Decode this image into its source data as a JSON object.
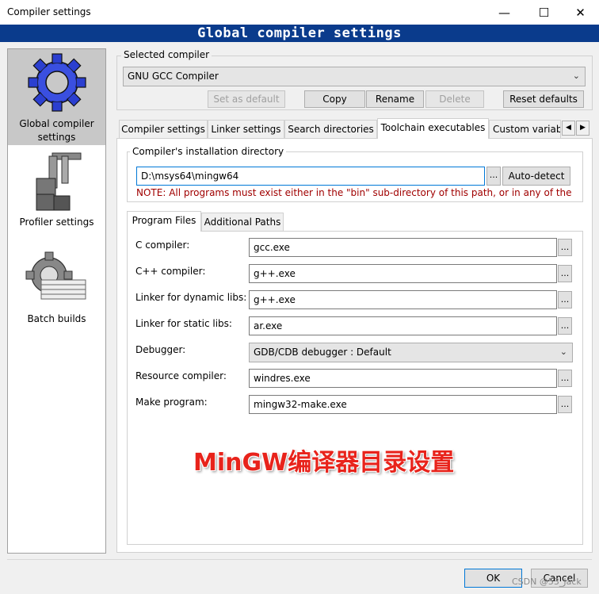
{
  "window": {
    "title": "Compiler settings",
    "banner": "Global compiler settings"
  },
  "sidebar": {
    "items": [
      {
        "label": "Global compiler settings"
      },
      {
        "label": "Profiler settings"
      },
      {
        "label": "Batch builds"
      }
    ]
  },
  "selected_compiler": {
    "group_label": "Selected compiler",
    "value": "GNU GCC Compiler",
    "buttons": {
      "set_default": "Set as default",
      "copy": "Copy",
      "rename": "Rename",
      "delete": "Delete",
      "reset": "Reset defaults"
    }
  },
  "tabs": [
    "Compiler settings",
    "Linker settings",
    "Search directories",
    "Toolchain executables",
    "Custom variab"
  ],
  "install_dir": {
    "group_label": "Compiler's installation directory",
    "value": "D:\\msys64\\mingw64",
    "ellipsis": "...",
    "auto_detect": "Auto-detect",
    "note": "NOTE: All programs must exist either in the \"bin\" sub-directory of this path, or in any of the"
  },
  "subtabs": [
    "Program Files",
    "Additional Paths"
  ],
  "programs": {
    "c_compiler": {
      "label": "C compiler:",
      "value": "gcc.exe"
    },
    "cpp_compiler": {
      "label": "C++ compiler:",
      "value": "g++.exe"
    },
    "linker_dynamic": {
      "label": "Linker for dynamic libs:",
      "value": "g++.exe"
    },
    "linker_static": {
      "label": "Linker for static libs:",
      "value": "ar.exe"
    },
    "debugger": {
      "label": "Debugger:",
      "value": "GDB/CDB debugger : Default"
    },
    "resource_compiler": {
      "label": "Resource compiler:",
      "value": "windres.exe"
    },
    "make_program": {
      "label": "Make program:",
      "value": "mingw32-make.exe"
    }
  },
  "overlay_caption": "MinGW编译器目录设置",
  "footer": {
    "ok": "OK",
    "cancel": "Cancel",
    "watermark": "CSDN @53_Jack"
  },
  "colors": {
    "banner": "#0a3b8c",
    "note": "#a00000",
    "overlay": "#e8231b"
  }
}
